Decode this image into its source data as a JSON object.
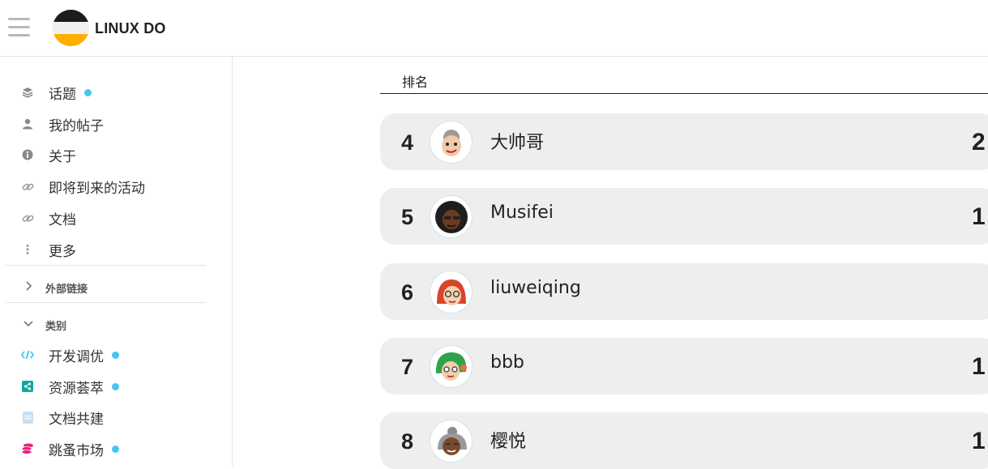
{
  "header": {
    "site_name": "LINUX DO",
    "menu_icon": "hamburger-menu-icon",
    "logo_colors": [
      "#1c1c1e",
      "#f0f0f0",
      "#ffb003"
    ]
  },
  "sidebar": {
    "items": [
      {
        "label": "话题",
        "icon": "layers-icon",
        "unread": true
      },
      {
        "label": "我的帖子",
        "icon": "user-icon",
        "unread": false
      },
      {
        "label": "关于",
        "icon": "info-icon",
        "unread": false
      },
      {
        "label": "即将到来的活动",
        "icon": "link-icon",
        "unread": false
      },
      {
        "label": "文档",
        "icon": "link-icon",
        "unread": false
      },
      {
        "label": "更多",
        "icon": "more-vertical-icon",
        "unread": false
      }
    ],
    "sections": {
      "external_links": "外部链接",
      "categories": "类别"
    },
    "categories": [
      {
        "label": "开发调优",
        "icon": "code-icon",
        "color": "#25c9e6",
        "unread": true
      },
      {
        "label": "资源荟萃",
        "icon": "share-icon",
        "color": "#12a89d",
        "unread": true
      },
      {
        "label": "文档共建",
        "icon": "document-icon",
        "color": "#c7def2",
        "unread": false
      },
      {
        "label": "跳蚤市场",
        "icon": "coins-icon",
        "color": "#ed207b",
        "unread": true
      }
    ],
    "unread_dot_color": "#48c4f4"
  },
  "leaderboard": {
    "column_header": "排名",
    "rows": [
      {
        "rank": "4",
        "username": "大帅哥",
        "score": "2"
      },
      {
        "rank": "5",
        "username": "Musifei",
        "score": "1"
      },
      {
        "rank": "6",
        "username": "liuweiqing",
        "score": ""
      },
      {
        "rank": "7",
        "username": "bbb",
        "score": "1"
      },
      {
        "rank": "8",
        "username": "樱悦",
        "score": "1"
      }
    ]
  }
}
